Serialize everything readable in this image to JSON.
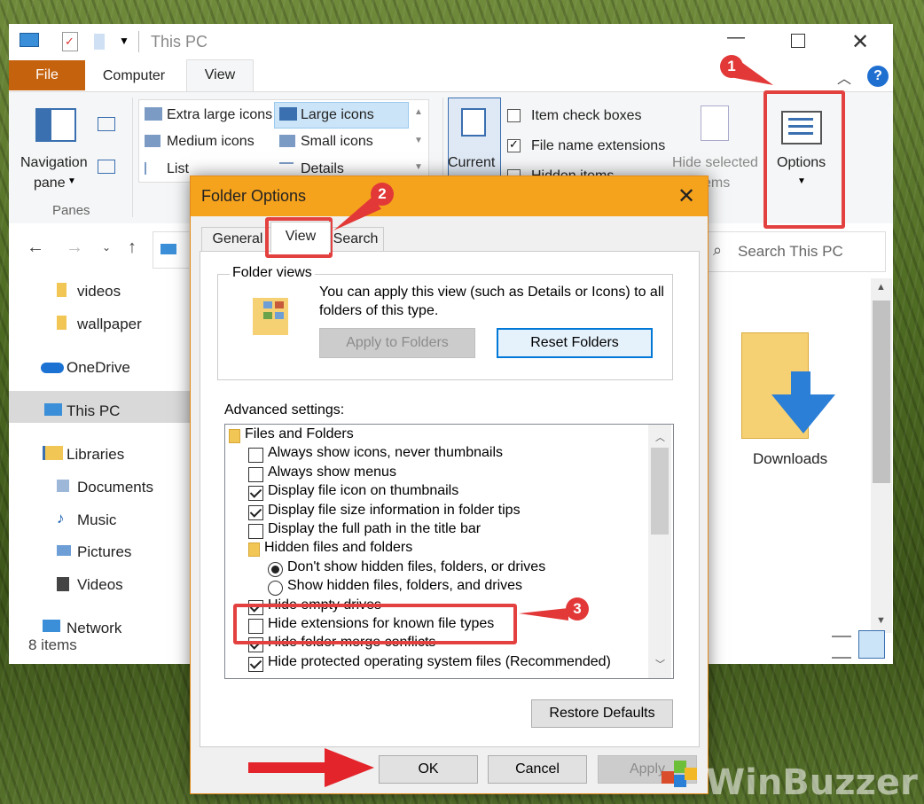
{
  "titlebar": {
    "title": "This PC"
  },
  "ribbon": {
    "tabs": {
      "file": "File",
      "computer": "Computer",
      "view": "View"
    },
    "panes": {
      "navigation_pane": "Navigation",
      "pane_word": "pane",
      "group": "Panes"
    },
    "layout": {
      "extra_large_icons": "Extra large icons",
      "large_icons": "Large icons",
      "medium_icons": "Medium icons",
      "small_icons": "Small icons",
      "list": "List",
      "details": "Details"
    },
    "current_view": {
      "current": "Current"
    },
    "show_hide": {
      "item_check_boxes": "Item check boxes",
      "file_name_extensions": "File name extensions",
      "hidden_items": "Hidden items",
      "hide_selected": "Hide selected",
      "items": "items"
    },
    "options": "Options"
  },
  "address": {
    "search_placeholder": "Search This PC"
  },
  "nav": {
    "items": [
      "videos",
      "wallpaper",
      "OneDrive",
      "This PC",
      "Libraries",
      "Documents",
      "Music",
      "Pictures",
      "Videos",
      "Network"
    ]
  },
  "content": {
    "downloads": "Downloads"
  },
  "status": {
    "items": "8 items"
  },
  "dialog": {
    "title": "Folder Options",
    "tabs": {
      "general": "General",
      "view": "View",
      "search": "Search"
    },
    "folder_views": {
      "label": "Folder views",
      "description": "You can apply this view (such as Details or Icons) to all folders of this type.",
      "apply_button": "Apply to Folders",
      "reset_button": "Reset Folders"
    },
    "advanced_label": "Advanced settings:",
    "advanced_rows": [
      {
        "kind": "folder",
        "text": "Files and Folders",
        "indent": 0,
        "checked": false
      },
      {
        "kind": "checkbox",
        "text": "Always show icons, never thumbnails",
        "indent": 1,
        "checked": false
      },
      {
        "kind": "checkbox",
        "text": "Always show menus",
        "indent": 1,
        "checked": false
      },
      {
        "kind": "checkbox",
        "text": "Display file icon on thumbnails",
        "indent": 1,
        "checked": true
      },
      {
        "kind": "checkbox",
        "text": "Display file size information in folder tips",
        "indent": 1,
        "checked": true
      },
      {
        "kind": "checkbox",
        "text": "Display the full path in the title bar",
        "indent": 1,
        "checked": false
      },
      {
        "kind": "folder",
        "text": "Hidden files and folders",
        "indent": 1,
        "checked": false
      },
      {
        "kind": "radio",
        "text": "Don't show hidden files, folders, or drives",
        "indent": 2,
        "checked": true
      },
      {
        "kind": "radio",
        "text": "Show hidden files, folders, and drives",
        "indent": 2,
        "checked": false
      },
      {
        "kind": "checkbox",
        "text": "Hide empty drives",
        "indent": 1,
        "checked": true
      },
      {
        "kind": "checkbox",
        "text": "Hide extensions for known file types",
        "indent": 1,
        "checked": false
      },
      {
        "kind": "checkbox",
        "text": "Hide folder merge conflicts",
        "indent": 1,
        "checked": true
      },
      {
        "kind": "checkbox",
        "text": "Hide protected operating system files (Recommended)",
        "indent": 1,
        "checked": true
      }
    ],
    "restore_defaults": "Restore Defaults",
    "ok": "OK",
    "cancel": "Cancel",
    "apply": "Apply"
  },
  "callouts": [
    "1",
    "2",
    "3"
  ],
  "watermark": "WinBuzzer",
  "colors": {
    "accent_orange": "#f5a21d",
    "file_tab": "#c5620d",
    "callout_red": "#e23838",
    "highlight_blue": "#0078d7"
  }
}
